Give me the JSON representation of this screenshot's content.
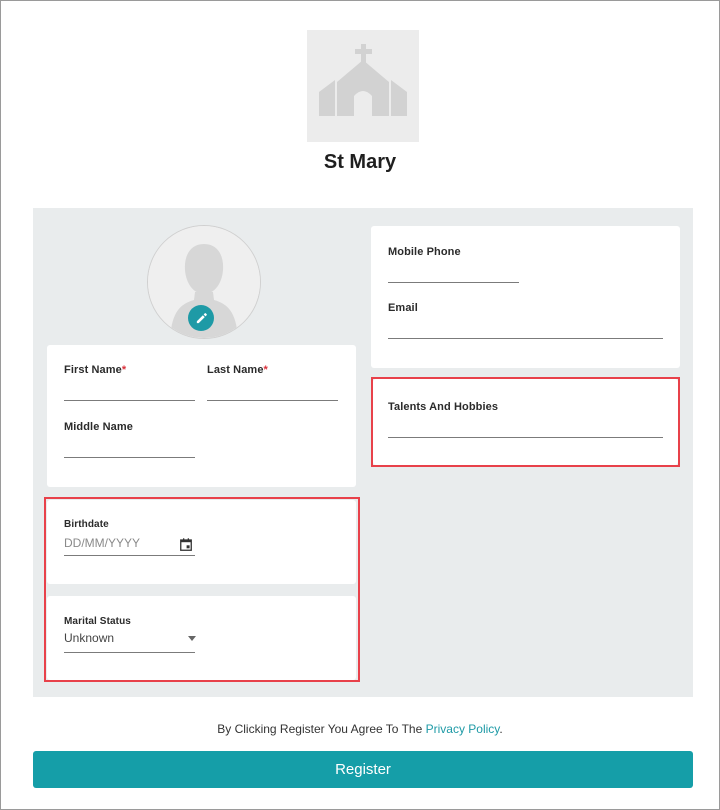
{
  "organization": {
    "name": "St Mary",
    "logo_icon": "church-icon"
  },
  "profile": {
    "avatar_icon": "user-silhouette-icon",
    "edit_icon": "pencil-icon"
  },
  "name_card": {
    "first_name_label": "First Name",
    "last_name_label": "Last Name",
    "middle_name_label": "Middle Name",
    "required_marker": "*"
  },
  "contact_card": {
    "mobile_phone_label": "Mobile Phone",
    "email_label": "Email"
  },
  "talents_card": {
    "label": "Talents And Hobbies"
  },
  "birthdate": {
    "label": "Birthdate",
    "placeholder": "DD/MM/YYYY",
    "icon": "calendar-icon"
  },
  "marital_status": {
    "label": "Marital Status",
    "selected": "Unknown",
    "icon": "caret-down-icon"
  },
  "footer": {
    "agree_text": "By Clicking Register You Agree To The ",
    "privacy_link": "Privacy Policy",
    "agree_end": ".",
    "register_label": "Register"
  },
  "colors": {
    "accent": "#159ea8",
    "highlight": "#e8414a",
    "panel_bg": "#e9eced",
    "required": "#d9303a"
  }
}
